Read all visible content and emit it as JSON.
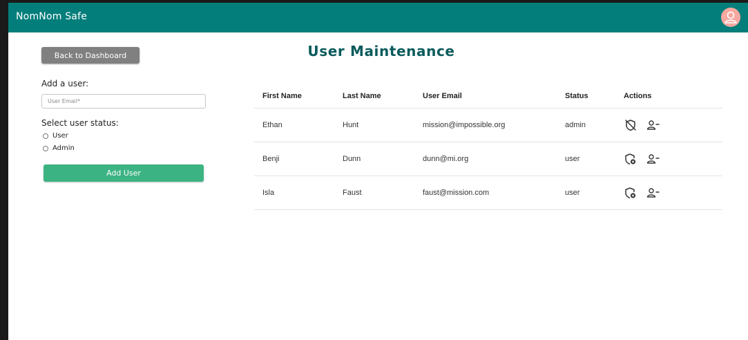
{
  "app": {
    "title": "NomNom Safe"
  },
  "nav": {
    "back_label": "Back to Dashboard"
  },
  "page": {
    "title": "User Maintenance"
  },
  "form": {
    "add_label": "Add a user:",
    "email_placeholder": "User Email*",
    "status_label": "Select user status:",
    "options": [
      "User",
      "Admin"
    ],
    "submit_label": "Add User"
  },
  "table": {
    "headers": [
      "First Name",
      "Last Name",
      "User Email",
      "Status",
      "Actions"
    ],
    "rows": [
      {
        "first": "Ethan",
        "last": "Hunt",
        "email": "mission@impossible.org",
        "status": "admin",
        "role_icon": "shield-off-icon",
        "remove_icon": "remove-user-icon"
      },
      {
        "first": "Benji",
        "last": "Dunn",
        "email": "dunn@mi.org",
        "status": "user",
        "role_icon": "shield-plus-icon",
        "remove_icon": "remove-user-icon"
      },
      {
        "first": "Isla",
        "last": "Faust",
        "email": "faust@mission.com",
        "status": "user",
        "role_icon": "shield-plus-icon",
        "remove_icon": "remove-user-icon"
      }
    ]
  },
  "colors": {
    "appbar": "#047e7b",
    "title": "#0b5b5c",
    "add_button": "#3cb383",
    "back_button": "#808080",
    "avatar": "#f7a8a0"
  }
}
